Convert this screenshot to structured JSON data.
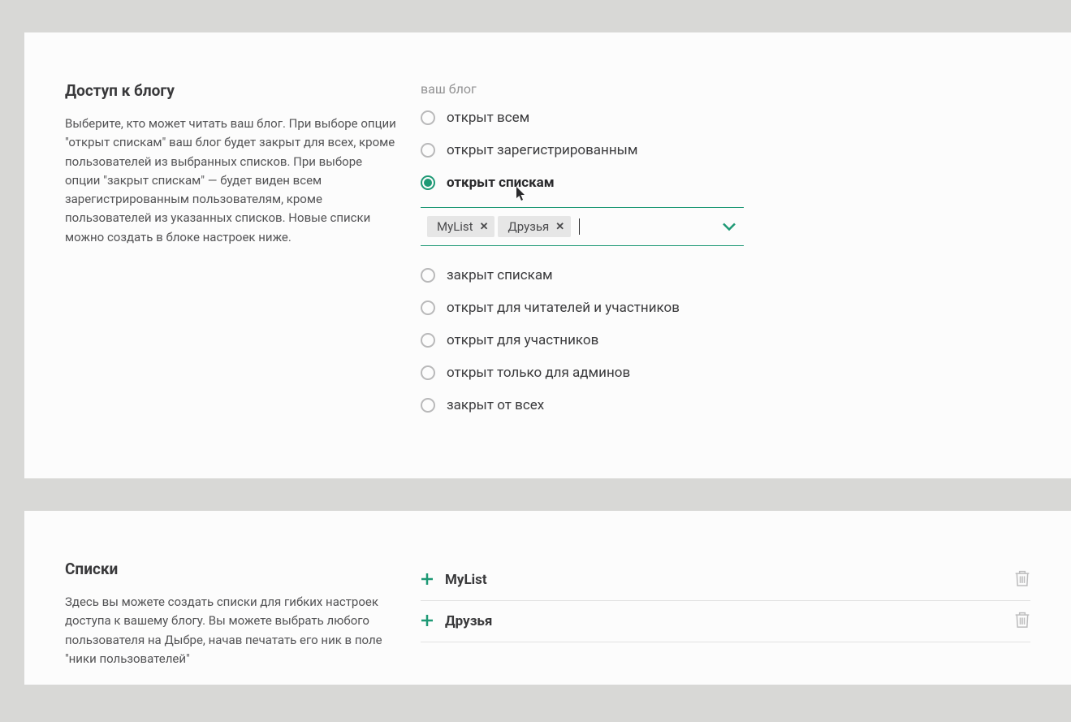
{
  "access": {
    "title": "Доступ к блогу",
    "description": "Выберите, кто может читать ваш блог. При выборе опции \"открыт спискам\" ваш блог будет закрыт для всех, кроме пользователей из выбранных списков. При выборе опции \"закрыт спискам\" — будет виден всем зарегистрированным пользователям, кроме пользователей из указанных списков. Новые списки можно создать в блоке настроек ниже.",
    "field_label": "ваш блог",
    "options": [
      "открыт всем",
      "открыт зарегистрированным",
      "открыт спискам",
      "закрыт спискам",
      "открыт для читателей и участников",
      "открыт для участников",
      "открыт только для админов",
      "закрыт от всех"
    ],
    "selected_index": 2,
    "tags": [
      "MyList",
      "Друзья"
    ]
  },
  "lists": {
    "title": "Списки",
    "description": "Здесь вы можете создать списки для гибких настроек доступа к вашему блогу. Вы можете выбрать любого пользователя на Дыбре, начав печатать его ник в поле \"ники пользователей\"",
    "items": [
      "MyList",
      "Друзья"
    ]
  }
}
